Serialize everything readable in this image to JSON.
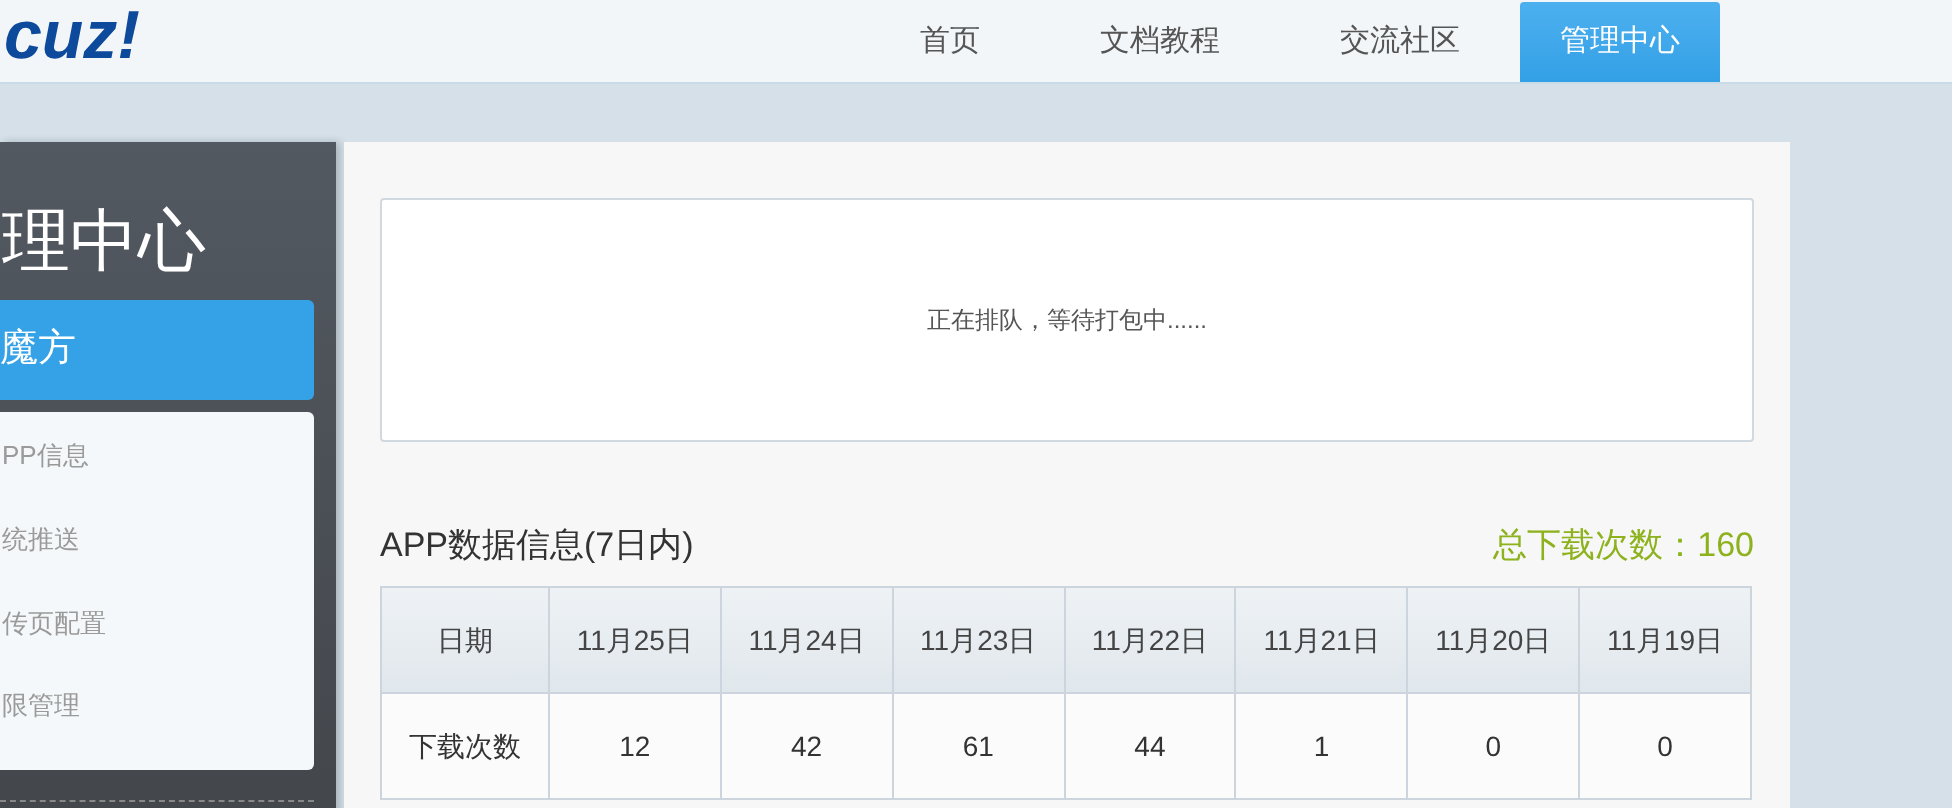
{
  "logo": {
    "text": "cuz!"
  },
  "nav": [
    {
      "label": "首页",
      "selected": false
    },
    {
      "label": "文档教程",
      "selected": false
    },
    {
      "label": "交流社区",
      "selected": false
    },
    {
      "label": "管理中心",
      "selected": true
    }
  ],
  "sidebar": {
    "title": "理中心",
    "section": "魔方",
    "items": [
      {
        "label": "PP信息"
      },
      {
        "label": "统推送"
      },
      {
        "label": "传页配置"
      },
      {
        "label": "限管理"
      }
    ]
  },
  "status": {
    "message": "正在排队，等待打包中......"
  },
  "stats": {
    "title": "APP数据信息(7日内)",
    "total": "总下载次数：160",
    "columns": [
      "日期",
      "11月25日",
      "11月24日",
      "11月23日",
      "11月22日",
      "11月21日",
      "11月20日",
      "11月19日"
    ],
    "row": [
      "下载次数",
      "12",
      "42",
      "61",
      "44",
      "1",
      "0",
      "0"
    ]
  }
}
